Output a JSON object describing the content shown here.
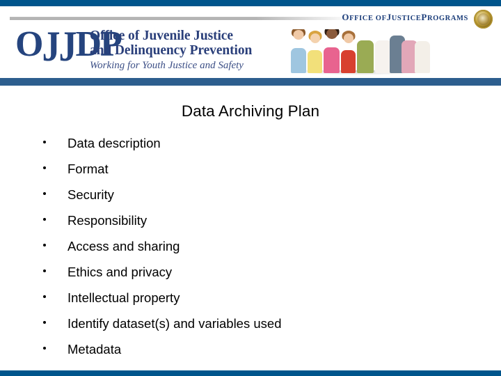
{
  "slide": {
    "title": "Data Archiving Plan",
    "bullets": [
      "Data description",
      "Format",
      "Security",
      "Responsibility",
      "Access and sharing",
      "Ethics and privacy",
      "Intellectual property",
      "Identify dataset(s) and variables used",
      "Metadata"
    ]
  },
  "header": {
    "ojp_label_part1": "O",
    "ojp_label_part2": "FFICE OF ",
    "ojp_label_part3": "J",
    "ojp_label_part4": "USTICE ",
    "ojp_label_part5": "P",
    "ojp_label_part6": "ROGRAMS",
    "ojp_full_label": "Office of Justice Programs",
    "seal_name": "doj-seal",
    "logo_mark": "OJJDP",
    "org_line1": "Office of Juvenile Justice",
    "org_line2": "and Delinquency Prevention",
    "tagline": "Working for Youth Justice and Safety",
    "photo_alt": "group of diverse youth"
  },
  "colors": {
    "top_bar": "#00558c",
    "header_bottom_bar": "#2d5e8e",
    "footer_bar": "#00558c",
    "logo_navy": "#25447e",
    "org_text": "#2a3f7a",
    "body_text": "#000000",
    "page_background": "#ffffff"
  }
}
